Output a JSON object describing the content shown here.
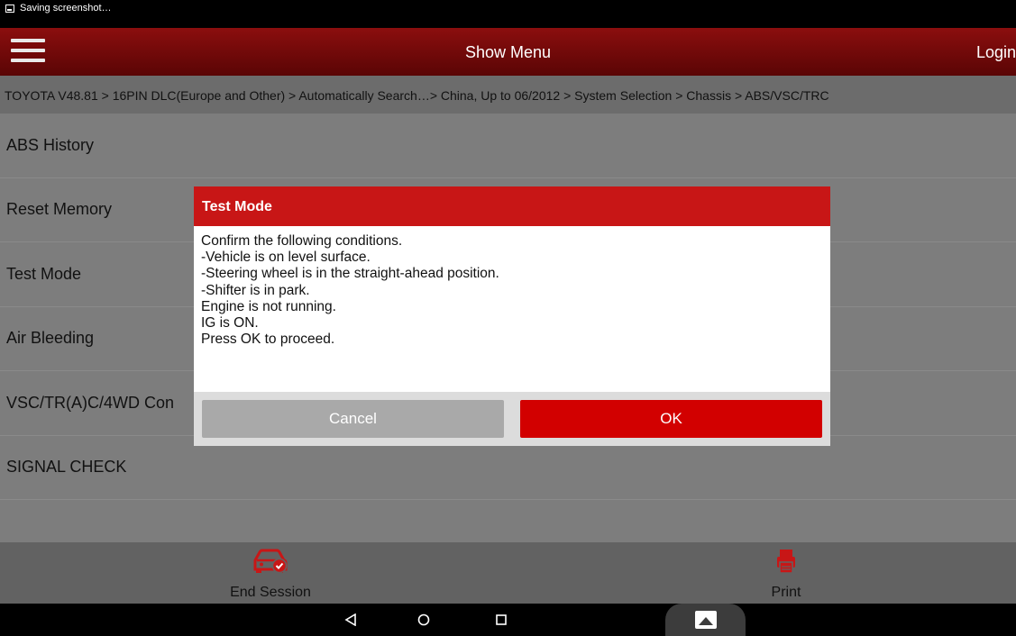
{
  "status_bar": {
    "text": "Saving screenshot…"
  },
  "app_bar": {
    "title": "Show Menu",
    "login_label": "Login"
  },
  "breadcrumb": "TOYOTA V48.81 > 16PIN DLC(Europe and Other) > Automatically Search…> China, Up to 06/2012 > System Selection > Chassis > ABS/VSC/TRC",
  "menu": {
    "items": [
      {
        "label": "ABS History"
      },
      {
        "label": "Reset Memory"
      },
      {
        "label": "Test Mode"
      },
      {
        "label": "Air Bleeding"
      },
      {
        "label": "VSC/TR(A)C/4WD Con"
      },
      {
        "label": "SIGNAL CHECK"
      }
    ]
  },
  "bottom_bar": {
    "end_session_label": "End Session",
    "print_label": "Print"
  },
  "dialog": {
    "title": "Test Mode",
    "lines": [
      "Confirm the following conditions.",
      "-Vehicle is on level surface.",
      "-Steering wheel is in the straight-ahead position.",
      "-Shifter is in park.",
      "Engine is not running.",
      "IG is ON.",
      "Press OK to proceed."
    ],
    "cancel_label": "Cancel",
    "ok_label": "OK"
  },
  "colors": {
    "accent": "#c81616",
    "ok_button": "#d20000",
    "cancel_button": "#a9a9a9",
    "app_bar": "#7a0b0b"
  }
}
